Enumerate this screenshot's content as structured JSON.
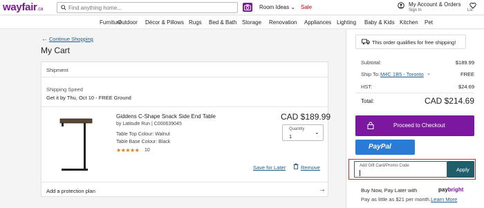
{
  "header": {
    "logo_main": "wayfair",
    "logo_suffix": ".ca",
    "search_placeholder": "Find anything home...",
    "room_ideas": "Room Ideas",
    "sale": "Sale",
    "account": "My Account & Orders",
    "sign_in": "Sign In",
    "lists": "Lis"
  },
  "nav": {
    "items": [
      "Furniture",
      "Outdoor",
      "Décor & Pillows",
      "Rugs",
      "Bed & Bath",
      "Storage",
      "Renovation",
      "Appliances",
      "Lighting",
      "Baby & Kids",
      "Kitchen",
      "Pet"
    ]
  },
  "cart": {
    "continue": "Continue Shopping",
    "title": "My Cart",
    "shipment": "Shipment",
    "shipping_speed_label": "Shipping Speed",
    "shipping_date": "Get it by Thu, Oct 10 - FREE Ground",
    "protection": "Add a protection plan"
  },
  "product": {
    "name": "Giddens C-Shape Snack Side End Table",
    "by": "by Latitude Run  |  C000639045",
    "attr1": "Table Top Colour: Walnut",
    "attr2": "Table Base Colour: Black",
    "stars": "★★★★★",
    "rating": 4.5,
    "rating_count": "10",
    "price": "CAD $189.99",
    "quantity_label": "Quantity",
    "quantity_value": "1",
    "save_for_later": "Save for Later",
    "remove": "Remove"
  },
  "summary": {
    "free_shipping": "This order qualifies for free shipping!",
    "subtotal_label": "Subtotal:",
    "subtotal_value": "$189.99",
    "ship_to_label": "Ship To:",
    "ship_to_value": "M4C 1B5 - Toronto",
    "ship_cost": "FREE",
    "hst_label": "HST:",
    "hst_value": "$24.69",
    "total_label": "Total:",
    "total_value": "CAD $214.69",
    "checkout": "Proceed to Checkout",
    "paypal": "PayPal",
    "promo_label": "Add Gift Card/Promo Code",
    "apply": "Apply",
    "bnpl": "Buy Now, Pay Later with",
    "paybright_pay": "pay",
    "paybright_bright": "bright",
    "as_low": "Pay as little as $21 per month.",
    "learn_more": "Learn More"
  },
  "colors": {
    "brand": "#7b189f",
    "link": "#1a5c8c",
    "apply": "#1f5f6b",
    "paypal": "#2a7bd6",
    "highlight": "#d62828"
  }
}
